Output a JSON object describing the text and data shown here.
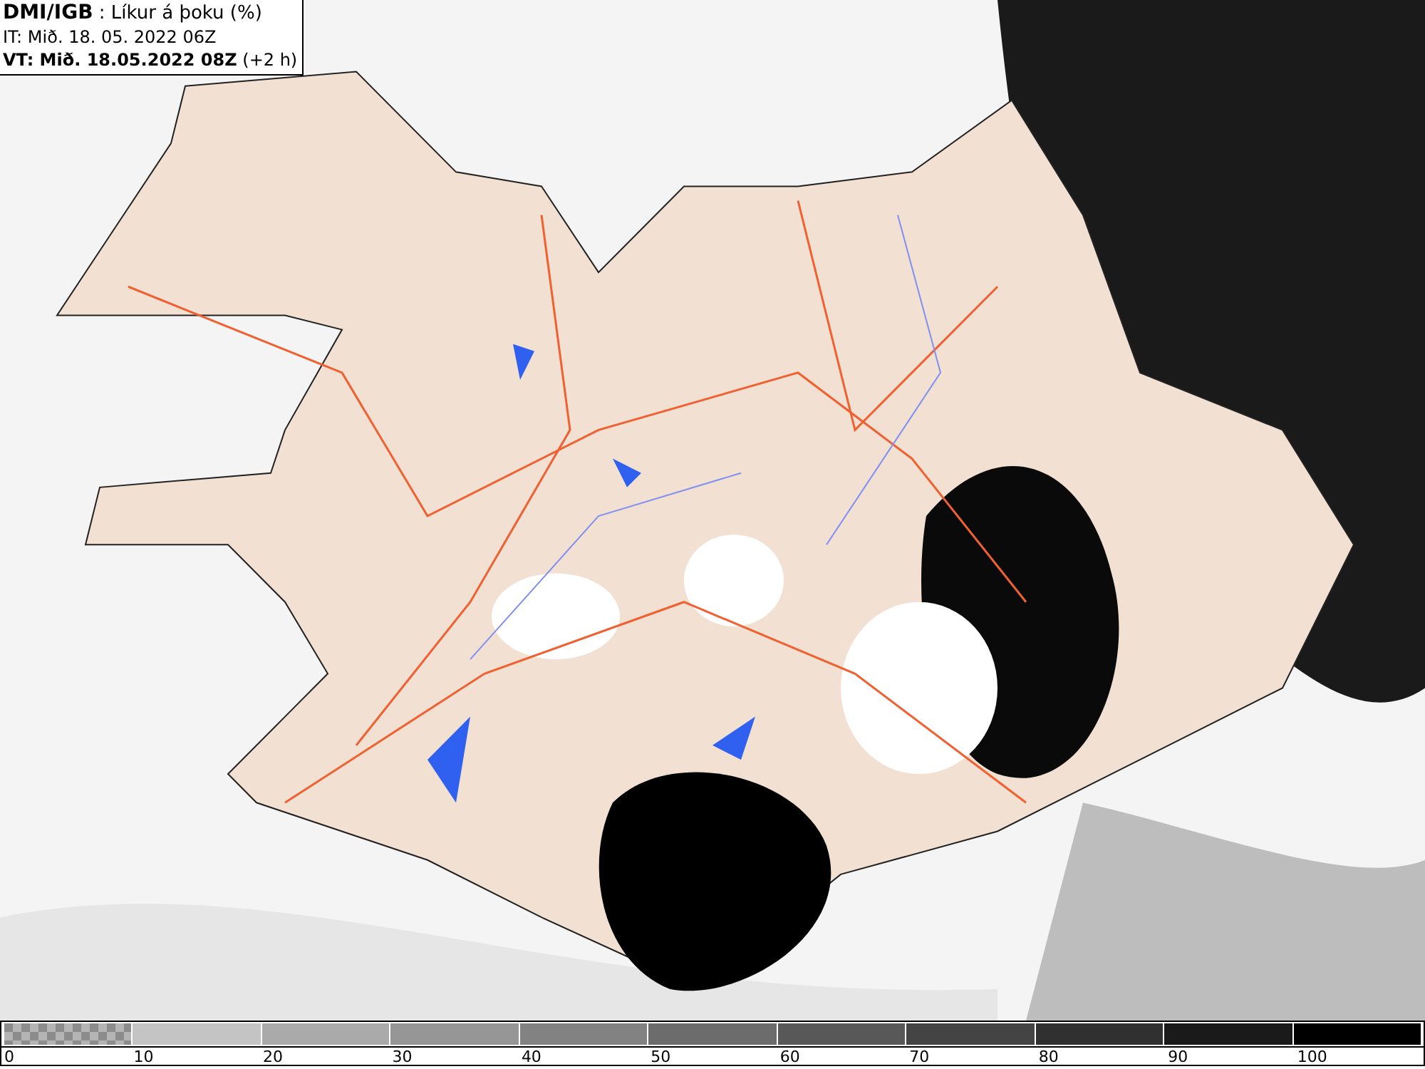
{
  "header": {
    "title": "**DMI/IGB** : Líkur á þoku (%)",
    "issued": "IT: Mið. 18. 05. 2022 06Z",
    "valid": "**VT: Mið. 18.05.2022 08Z** (+2 h)"
  },
  "legend": {
    "swatches": [
      {
        "kind": "checker",
        "color": "#8c8c8c"
      },
      {
        "kind": "solid",
        "color": "#c4c4c4"
      },
      {
        "kind": "solid",
        "color": "#aaaaaa"
      },
      {
        "kind": "solid",
        "color": "#969696"
      },
      {
        "kind": "solid",
        "color": "#828282"
      },
      {
        "kind": "solid",
        "color": "#6c6c6c"
      },
      {
        "kind": "solid",
        "color": "#585858"
      },
      {
        "kind": "solid",
        "color": "#444444"
      },
      {
        "kind": "solid",
        "color": "#303030"
      },
      {
        "kind": "solid",
        "color": "#1a1a1a"
      },
      {
        "kind": "solid",
        "color": "#000000"
      }
    ],
    "labels": [
      "0",
      "10",
      "20",
      "30",
      "40",
      "50",
      "60",
      "70",
      "80",
      "90",
      "100"
    ]
  }
}
